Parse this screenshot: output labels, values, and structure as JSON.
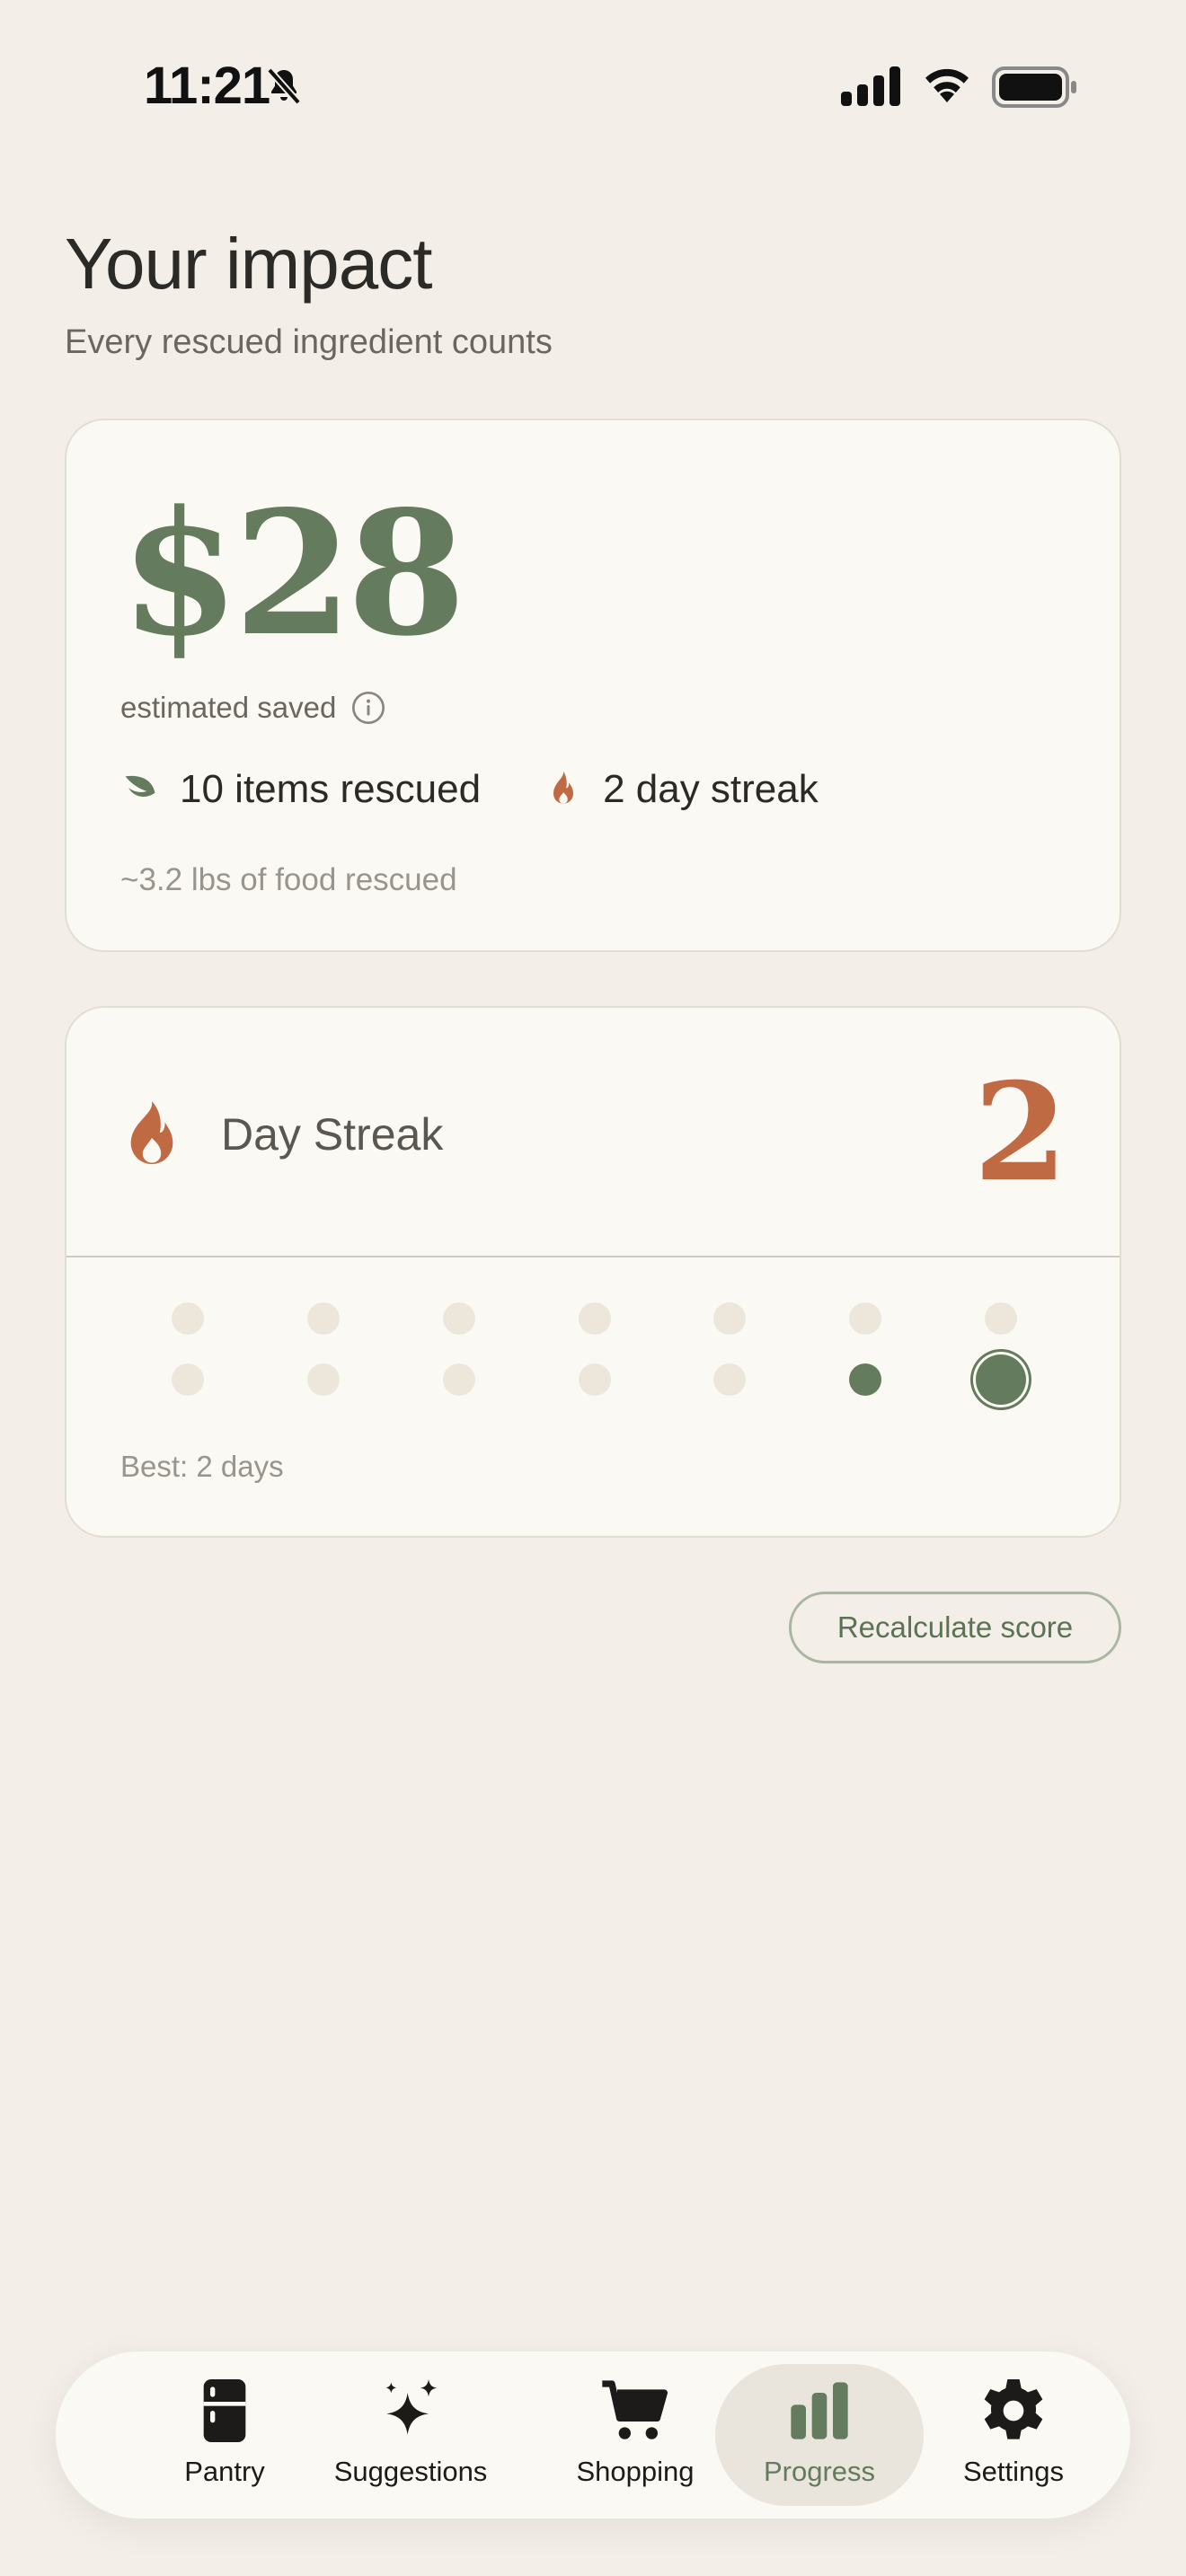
{
  "status_bar": {
    "time": "11:21"
  },
  "header": {
    "title": "Your impact",
    "subtitle": "Every rescued ingredient counts"
  },
  "impact": {
    "amount": "$28",
    "estimated_label": "estimated saved",
    "items_rescued": "10 items rescued",
    "streak_summary": "2 day streak",
    "food_rescued": "~3.2 lbs of food rescued"
  },
  "streak": {
    "label": "Day Streak",
    "count": "2",
    "best": "Best: 2 days",
    "days": [
      "empty",
      "empty",
      "empty",
      "empty",
      "empty",
      "empty",
      "empty",
      "empty",
      "empty",
      "empty",
      "empty",
      "empty",
      "done",
      "today"
    ]
  },
  "actions": {
    "recalculate": "Recalculate score"
  },
  "tabs": [
    {
      "label": "Pantry",
      "icon": "fridge-icon",
      "active": false
    },
    {
      "label": "Suggestions",
      "icon": "sparkles-icon",
      "active": false
    },
    {
      "label": "Shopping",
      "icon": "cart-icon",
      "active": false
    },
    {
      "label": "Progress",
      "icon": "bar-chart-icon",
      "active": true
    },
    {
      "label": "Settings",
      "icon": "gear-icon",
      "active": false
    }
  ],
  "colors": {
    "background": "#f3efe8",
    "card": "#fbf9f4",
    "accent_green": "#647b5d",
    "accent_orange": "#c06a43",
    "dot_empty": "#ede6db"
  }
}
